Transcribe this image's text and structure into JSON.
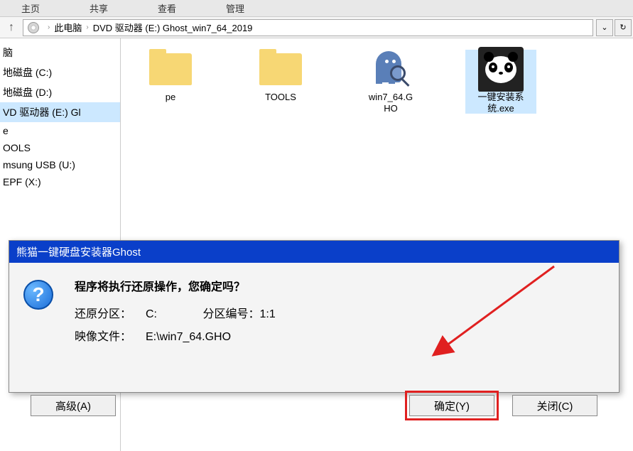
{
  "top_tabs": {
    "t1": "主页",
    "t2": "共享",
    "t3": "查看",
    "t4": "管理"
  },
  "breadcrumb": {
    "pc": "此电脑",
    "drive": "DVD 驱动器 (E:) Ghost_win7_64_2019"
  },
  "sidebar": {
    "items": [
      "脑",
      "地磁盘 (C:)",
      "地磁盘 (D:)",
      "VD 驱动器 (E:) Gl",
      "e",
      "OOLS",
      "msung USB (U:)",
      "EPF (X:)"
    ]
  },
  "files": [
    {
      "type": "folder",
      "label": "pe"
    },
    {
      "type": "folder",
      "label": "TOOLS"
    },
    {
      "type": "ghost",
      "label": "win7_64.G\nHO"
    },
    {
      "type": "panda",
      "label": "一键安装系\n统.exe"
    }
  ],
  "dialog": {
    "title": "熊猫一键硬盘安装器Ghost",
    "message": "程序将执行还原操作，您确定吗？",
    "partition_label": "还原分区：",
    "partition_value": "C:",
    "partnum_label": "分区编号：",
    "partnum_value": "1:1",
    "image_label": "映像文件：",
    "image_value": "E:\\win7_64.GHO",
    "btn_advanced": "高级(A)",
    "btn_ok": "确定(Y)",
    "btn_close": "关闭(C)"
  }
}
